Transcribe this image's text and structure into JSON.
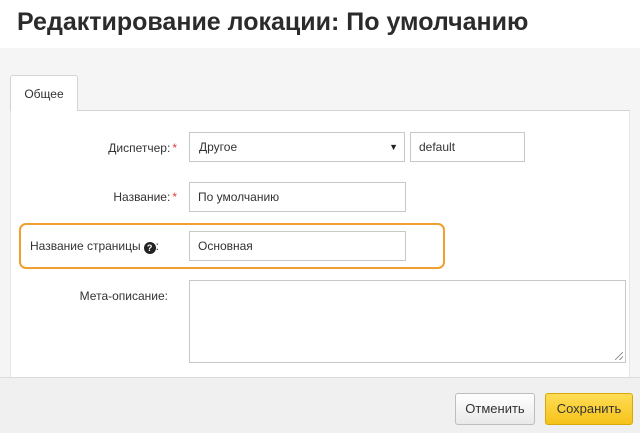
{
  "page": {
    "title": "Редактирование локации: По умолчанию"
  },
  "tabs": [
    {
      "label": "Общее"
    }
  ],
  "form": {
    "dispatcher": {
      "label": "Диспетчер:",
      "required_mark": "*",
      "selected": "Другое",
      "code_value": "default"
    },
    "name": {
      "label": "Название:",
      "required_mark": "*",
      "value": "По умолчанию"
    },
    "page_title": {
      "label": "Название страницы",
      "suffix": ":",
      "help_icon": "?",
      "value": "Основная"
    },
    "meta_description": {
      "label": "Мета-описание:",
      "value": ""
    }
  },
  "footer": {
    "cancel_label": "Отменить",
    "save_label": "Сохранить"
  },
  "colors": {
    "highlight": "#f0a030",
    "save_button": "#f5c21a",
    "required": "#e14040"
  }
}
